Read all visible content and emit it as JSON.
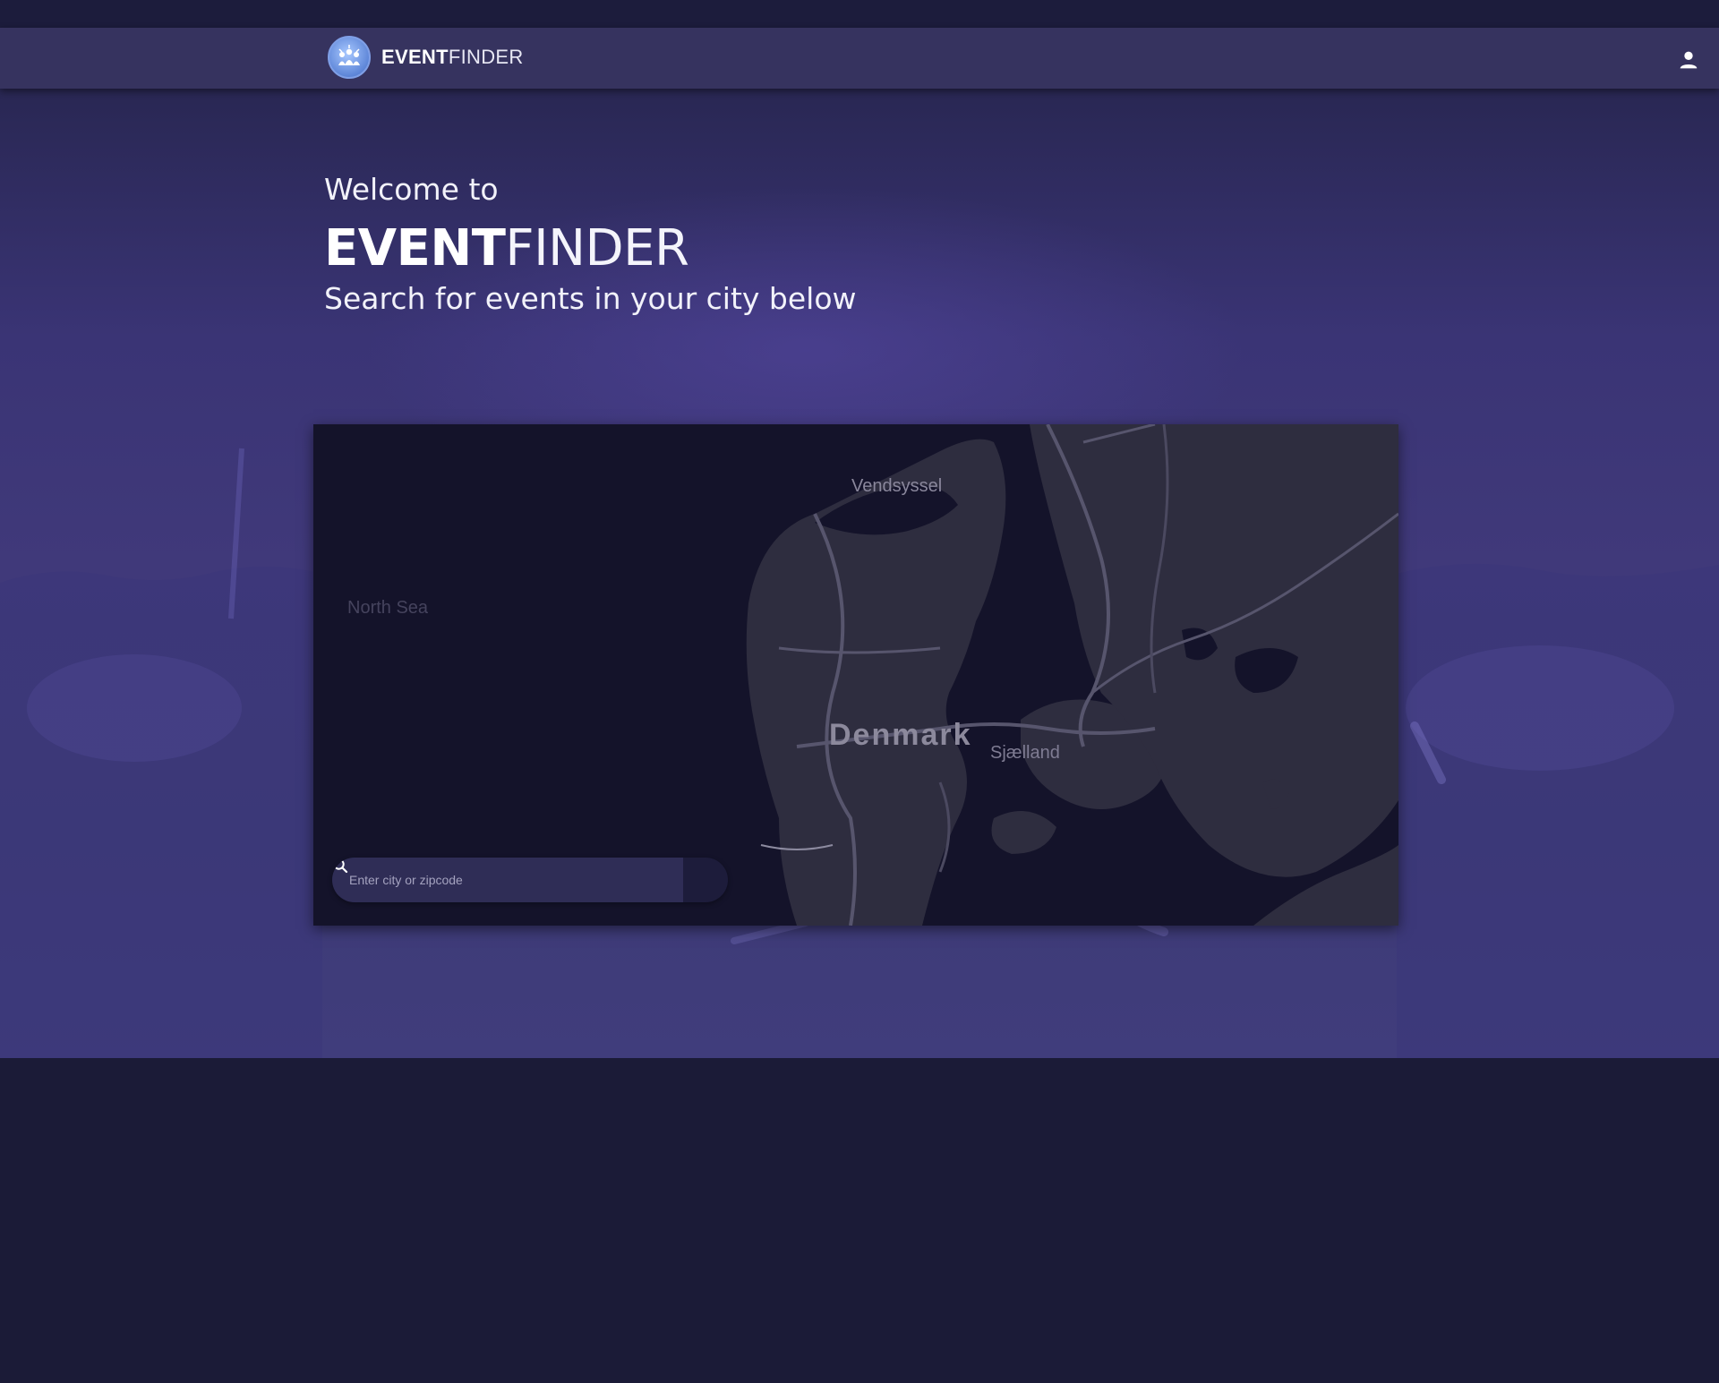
{
  "navbar": {
    "brand_bold": "EVENT",
    "brand_thin": "FINDER",
    "logo_icon": "event-crowd-logo-icon",
    "user_icon": "user-icon"
  },
  "hero": {
    "welcome": "Welcome to",
    "title_bold": "EVENT",
    "title_thin": "FINDER",
    "subtitle": "Search for events in your city below"
  },
  "map": {
    "labels": {
      "north_sea": "North Sea",
      "vendsyssel": "Vendsyssel",
      "denmark": "Denmark",
      "sjaelland": "Sjælland"
    }
  },
  "search": {
    "placeholder": "Enter city or zipcode",
    "value": "",
    "button_icon": "search-icon"
  },
  "colors": {
    "page_background": "#1b1b37",
    "navbar": "#36335f",
    "hero_purple": "#403d7c",
    "search_input": "#2f2d56",
    "search_button": "#1d1c3b"
  }
}
